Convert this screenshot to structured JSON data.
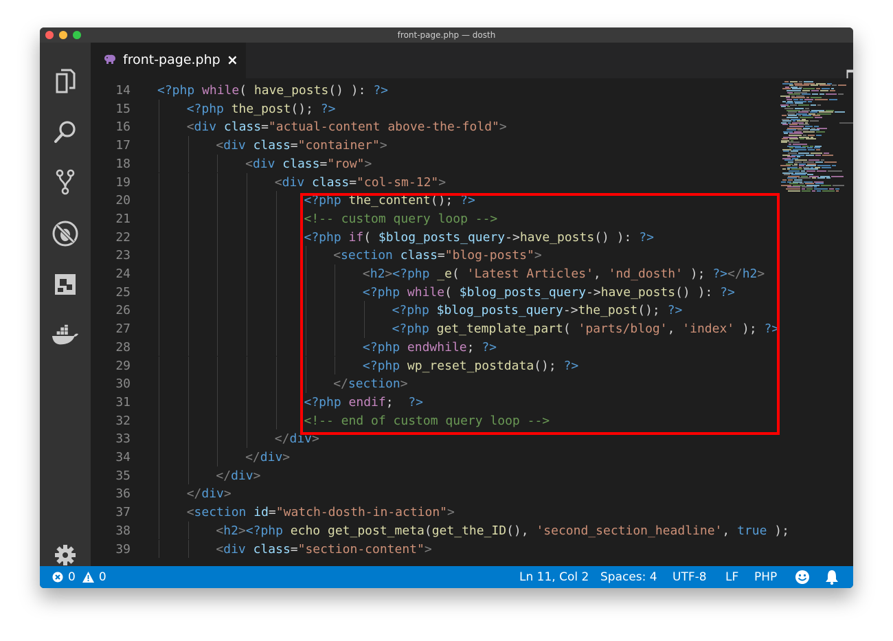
{
  "window": {
    "title": "front-page.php — dosth"
  },
  "tab": {
    "label": "front-page.php",
    "close": "×"
  },
  "toolbar": {
    "more": "···"
  },
  "lines": [
    {
      "n": "14",
      "indent": 0,
      "tokens": [
        [
          "<?php ",
          "kw"
        ],
        [
          "while",
          "pink"
        ],
        [
          "( ",
          "txt"
        ],
        [
          "have_posts",
          "fn"
        ],
        [
          "() ): ",
          "txt"
        ],
        [
          "?>",
          "kw"
        ]
      ]
    },
    {
      "n": "15",
      "indent": 1,
      "tokens": [
        [
          "<?php ",
          "kw"
        ],
        [
          "the_post",
          "fn"
        ],
        [
          "(); ",
          "txt"
        ],
        [
          "?>",
          "kw"
        ]
      ]
    },
    {
      "n": "16",
      "indent": 1,
      "tokens": [
        [
          "<",
          "tag"
        ],
        [
          "div ",
          "kw"
        ],
        [
          "class",
          "attr"
        ],
        [
          "=",
          "txt"
        ],
        [
          "\"actual-content above-the-fold\"",
          "str"
        ],
        [
          ">",
          "tag"
        ]
      ]
    },
    {
      "n": "17",
      "indent": 2,
      "tokens": [
        [
          "<",
          "tag"
        ],
        [
          "div ",
          "kw"
        ],
        [
          "class",
          "attr"
        ],
        [
          "=",
          "txt"
        ],
        [
          "\"container\"",
          "str"
        ],
        [
          ">",
          "tag"
        ]
      ]
    },
    {
      "n": "18",
      "indent": 3,
      "tokens": [
        [
          "<",
          "tag"
        ],
        [
          "div ",
          "kw"
        ],
        [
          "class",
          "attr"
        ],
        [
          "=",
          "txt"
        ],
        [
          "\"row\"",
          "str"
        ],
        [
          ">",
          "tag"
        ]
      ]
    },
    {
      "n": "19",
      "indent": 4,
      "tokens": [
        [
          "<",
          "tag"
        ],
        [
          "div ",
          "kw"
        ],
        [
          "class",
          "attr"
        ],
        [
          "=",
          "txt"
        ],
        [
          "\"col-sm-12\"",
          "str"
        ],
        [
          ">",
          "tag"
        ]
      ]
    },
    {
      "n": "20",
      "indent": 5,
      "tokens": [
        [
          "<?php ",
          "kw"
        ],
        [
          "the_content",
          "fn"
        ],
        [
          "(); ",
          "txt"
        ],
        [
          "?>",
          "kw"
        ]
      ]
    },
    {
      "n": "21",
      "indent": 5,
      "tokens": [
        [
          "<!-- custom query loop -->",
          "com"
        ]
      ]
    },
    {
      "n": "22",
      "indent": 5,
      "tokens": [
        [
          "<?php ",
          "kw"
        ],
        [
          "if",
          "pink"
        ],
        [
          "( ",
          "txt"
        ],
        [
          "$blog_posts_query",
          "var"
        ],
        [
          "->",
          "txt"
        ],
        [
          "have_posts",
          "fn"
        ],
        [
          "() ): ",
          "txt"
        ],
        [
          "?>",
          "kw"
        ]
      ]
    },
    {
      "n": "23",
      "indent": 6,
      "tokens": [
        [
          "<",
          "tag"
        ],
        [
          "section ",
          "kw"
        ],
        [
          "class",
          "attr"
        ],
        [
          "=",
          "txt"
        ],
        [
          "\"blog-posts\"",
          "str"
        ],
        [
          ">",
          "tag"
        ]
      ]
    },
    {
      "n": "24",
      "indent": 7,
      "tokens": [
        [
          "<",
          "tag"
        ],
        [
          "h2",
          "kw"
        ],
        [
          ">",
          "tag"
        ],
        [
          "<?php ",
          "kw"
        ],
        [
          "_e",
          "fn"
        ],
        [
          "( ",
          "txt"
        ],
        [
          "'Latest Articles'",
          "str"
        ],
        [
          ", ",
          "txt"
        ],
        [
          "'nd_dosth'",
          "str"
        ],
        [
          " ); ",
          "txt"
        ],
        [
          "?>",
          "kw"
        ],
        [
          "</",
          "tag"
        ],
        [
          "h2",
          "kw"
        ],
        [
          ">",
          "tag"
        ]
      ]
    },
    {
      "n": "25",
      "indent": 7,
      "tokens": [
        [
          "<?php ",
          "kw"
        ],
        [
          "while",
          "pink"
        ],
        [
          "( ",
          "txt"
        ],
        [
          "$blog_posts_query",
          "var"
        ],
        [
          "->",
          "txt"
        ],
        [
          "have_posts",
          "fn"
        ],
        [
          "() ): ",
          "txt"
        ],
        [
          "?>",
          "kw"
        ]
      ]
    },
    {
      "n": "26",
      "indent": 8,
      "tokens": [
        [
          "<?php ",
          "kw"
        ],
        [
          "$blog_posts_query",
          "var"
        ],
        [
          "->",
          "txt"
        ],
        [
          "the_post",
          "fn"
        ],
        [
          "(); ",
          "txt"
        ],
        [
          "?>",
          "kw"
        ]
      ]
    },
    {
      "n": "27",
      "indent": 8,
      "tokens": [
        [
          "<?php ",
          "kw"
        ],
        [
          "get_template_part",
          "fn"
        ],
        [
          "( ",
          "txt"
        ],
        [
          "'parts/blog'",
          "str"
        ],
        [
          ", ",
          "txt"
        ],
        [
          "'index'",
          "str"
        ],
        [
          " ); ",
          "txt"
        ],
        [
          "?>",
          "kw"
        ]
      ]
    },
    {
      "n": "28",
      "indent": 7,
      "tokens": [
        [
          "<?php ",
          "kw"
        ],
        [
          "endwhile",
          "pink"
        ],
        [
          "; ",
          "txt"
        ],
        [
          "?>",
          "kw"
        ]
      ]
    },
    {
      "n": "29",
      "indent": 7,
      "tokens": [
        [
          "<?php ",
          "kw"
        ],
        [
          "wp_reset_postdata",
          "fn"
        ],
        [
          "(); ",
          "txt"
        ],
        [
          "?>",
          "kw"
        ]
      ]
    },
    {
      "n": "30",
      "indent": 6,
      "tokens": [
        [
          "</",
          "tag"
        ],
        [
          "section",
          "kw"
        ],
        [
          ">",
          "tag"
        ]
      ]
    },
    {
      "n": "31",
      "indent": 5,
      "tokens": [
        [
          "<?php ",
          "kw"
        ],
        [
          "endif",
          "pink"
        ],
        [
          ";  ",
          "txt"
        ],
        [
          "?>",
          "kw"
        ]
      ]
    },
    {
      "n": "32",
      "indent": 5,
      "tokens": [
        [
          "<!-- end of custom query loop -->",
          "com"
        ]
      ]
    },
    {
      "n": "33",
      "indent": 4,
      "tokens": [
        [
          "</",
          "tag"
        ],
        [
          "div",
          "kw"
        ],
        [
          ">",
          "tag"
        ]
      ]
    },
    {
      "n": "34",
      "indent": 3,
      "tokens": [
        [
          "</",
          "tag"
        ],
        [
          "div",
          "kw"
        ],
        [
          ">",
          "tag"
        ]
      ]
    },
    {
      "n": "35",
      "indent": 2,
      "tokens": [
        [
          "</",
          "tag"
        ],
        [
          "div",
          "kw"
        ],
        [
          ">",
          "tag"
        ]
      ]
    },
    {
      "n": "36",
      "indent": 1,
      "tokens": [
        [
          "</",
          "tag"
        ],
        [
          "div",
          "kw"
        ],
        [
          ">",
          "tag"
        ]
      ]
    },
    {
      "n": "37",
      "indent": 1,
      "tokens": [
        [
          "<",
          "tag"
        ],
        [
          "section ",
          "kw"
        ],
        [
          "id",
          "attr"
        ],
        [
          "=",
          "txt"
        ],
        [
          "\"watch-dosth-in-action\"",
          "str"
        ],
        [
          ">",
          "tag"
        ]
      ]
    },
    {
      "n": "38",
      "indent": 2,
      "tokens": [
        [
          "<",
          "tag"
        ],
        [
          "h2",
          "kw"
        ],
        [
          ">",
          "tag"
        ],
        [
          "<?php ",
          "kw"
        ],
        [
          "echo ",
          "fn"
        ],
        [
          "get_post_meta",
          "fn"
        ],
        [
          "(",
          "txt"
        ],
        [
          "get_the_ID",
          "fn"
        ],
        [
          "(), ",
          "txt"
        ],
        [
          "'second_section_headline'",
          "str"
        ],
        [
          ", ",
          "txt"
        ],
        [
          "true",
          "kw"
        ],
        [
          " );",
          "txt"
        ]
      ]
    },
    {
      "n": "39",
      "indent": 2,
      "tokens": [
        [
          "<",
          "tag"
        ],
        [
          "div ",
          "kw"
        ],
        [
          "class",
          "attr"
        ],
        [
          "=",
          "txt"
        ],
        [
          "\"section-content\"",
          "str"
        ],
        [
          ">",
          "tag"
        ]
      ]
    }
  ],
  "statusbar": {
    "errors": "0",
    "warnings": "0",
    "position": "Ln 11, Col 2",
    "spaces": "Spaces: 4",
    "encoding": "UTF-8",
    "eol": "LF",
    "language": "PHP"
  },
  "icons": [
    "explorer-icon",
    "search-icon",
    "source-control-icon",
    "debug-icon",
    "extensions-icon",
    "docker-icon",
    "gear-icon",
    "split-editor-icon",
    "more-actions-icon",
    "php-elephant-icon",
    "error-icon",
    "warning-icon",
    "smiley-icon",
    "bell-icon"
  ],
  "colors": {
    "statusbar": "#007acc",
    "editor_bg": "#1e1e1e",
    "highlight": "#ff0000"
  }
}
